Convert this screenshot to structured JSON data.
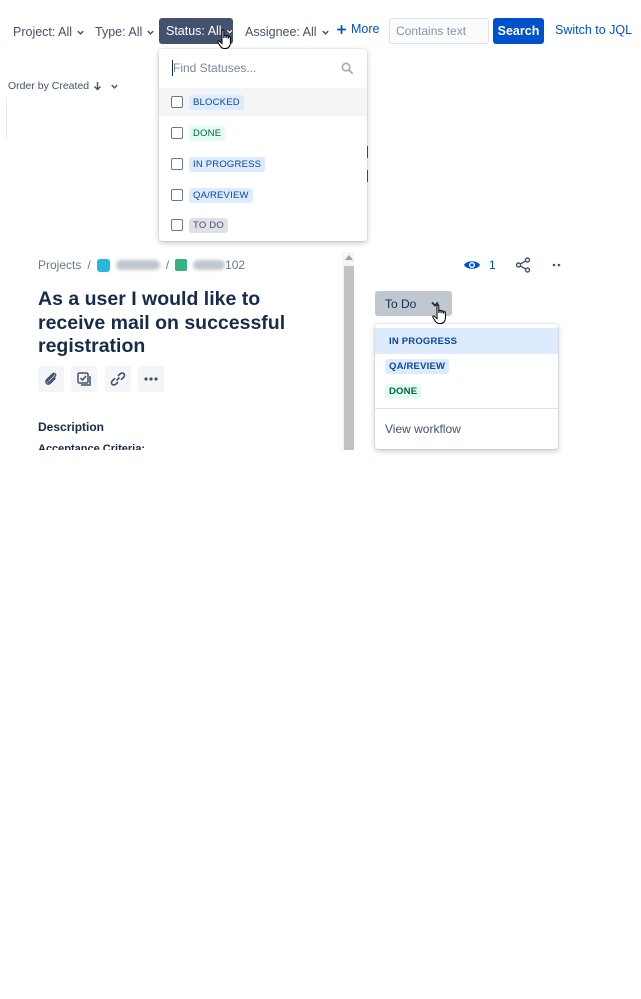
{
  "filters": {
    "project": "Project: All",
    "type": "Type: All",
    "status": "Status: All",
    "assignee": "Assignee: All",
    "more": "More",
    "text_placeholder": "Contains text",
    "search": "Search",
    "switch_jql": "Switch to JQL"
  },
  "order_by": "Order by Created",
  "status_dropdown": {
    "search_placeholder": "Find Statuses...",
    "options": [
      {
        "label": "BLOCKED",
        "style": "blue"
      },
      {
        "label": "DONE",
        "style": "green"
      },
      {
        "label": "IN PROGRESS",
        "style": "blue"
      },
      {
        "label": "QA/REVIEW",
        "style": "blue"
      },
      {
        "label": "TO DO",
        "style": "grey"
      }
    ]
  },
  "issue": {
    "breadcrumb_projects": "Projects",
    "separator": "/",
    "issue_number_suffix": "102",
    "title": "As a user I would like to receive mail on successful registration",
    "description_label": "Description",
    "acceptance_label": "Acceptance Criteria:",
    "watch_count": "1"
  },
  "status_button": {
    "label": "To Do"
  },
  "transitions": {
    "items": [
      {
        "label": "IN PROGRESS",
        "style": "blue"
      },
      {
        "label": "QA/REVIEW",
        "style": "blue"
      },
      {
        "label": "DONE",
        "style": "green"
      }
    ],
    "view_workflow": "View workflow"
  },
  "colors": {
    "primary": "#0052cc",
    "status_selected_bg": "#42526e",
    "todo_bg": "#c1c7d0",
    "lozenge_blue_bg": "#deebff",
    "lozenge_green_bg": "#e3fcef",
    "lozenge_grey_bg": "#dfe1e6"
  },
  "icons": {
    "chevron": "chevron-down-icon",
    "plus": "plus-icon",
    "search": "search-icon",
    "arrow_down": "arrow-down-icon",
    "attachment": "paperclip-icon",
    "subtask": "checklist-icon",
    "link": "link-icon",
    "more": "ellipsis-icon",
    "watch": "eye-icon",
    "share": "share-icon",
    "cursor": "hand-pointer-icon"
  }
}
